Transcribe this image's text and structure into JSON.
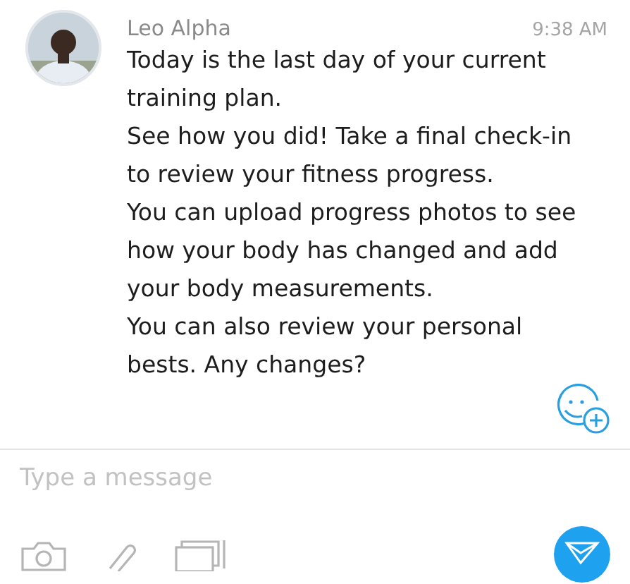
{
  "message": {
    "sender": "Leo Alpha",
    "time": "9:38 AM",
    "paragraphs": [
      "Today is the last day of your current training plan.",
      "See how you did! Take a final check-in to review your fitness progress.",
      "You can upload progress photos to see how your body has changed and add your body measurements.",
      "You can also review your personal bests. Any changes?"
    ]
  },
  "composer": {
    "placeholder": "Type a message"
  }
}
